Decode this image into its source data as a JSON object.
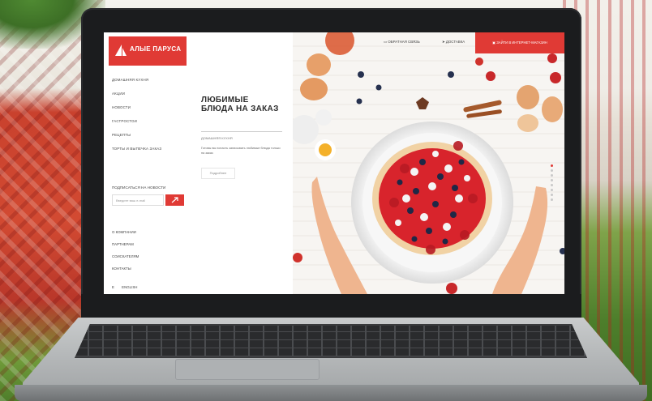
{
  "brand": {
    "logo_text": "АЛЫЕ ПАРУСА",
    "accent": "#e03a35"
  },
  "sidebar": {
    "nav_items": [
      {
        "label": "ДОМАШНЯЯ КУХНЯ"
      },
      {
        "label": "АКЦИИ"
      },
      {
        "label": "НОВОСТИ"
      },
      {
        "label": "ГАСТРОСТОИ"
      },
      {
        "label": "РЕЦЕПТЫ"
      },
      {
        "label": "ТОРТЫ И ВЫПЕЧКА ЗАКАЗ"
      }
    ],
    "subscribe_label": "ПОДПИСАТЬСЯ НА НОВОСТИ",
    "subscribe_placeholder": "Введите ваш e-mail",
    "bottom_items": [
      {
        "label": "О КОМПАНИИ"
      },
      {
        "label": "ПАРТНЕРАМ"
      },
      {
        "label": "СОИСКАТЕЛЯМ"
      },
      {
        "label": "КОНТАКТЫ"
      }
    ],
    "lang": [
      "Е",
      "ENGLISH"
    ]
  },
  "content": {
    "heading": "ЛЮБИМЫЕ БЛЮДА НА ЗАКАЗ",
    "subheading": "ДОМАШНЯЯ КУХНЯ",
    "description": "Готовы вы попасть записывать любимые блюда только на заказ",
    "more_button": "Подробнее"
  },
  "topbar": {
    "items": [
      "ОБРАТНАЯ СВЯЗЬ",
      "ДОСТАВКА"
    ],
    "cta": "ЗАЙТИ В ИНТЕРНЕТ-МАГАЗИН"
  },
  "slider": {
    "count": 8,
    "active_index": 0
  }
}
